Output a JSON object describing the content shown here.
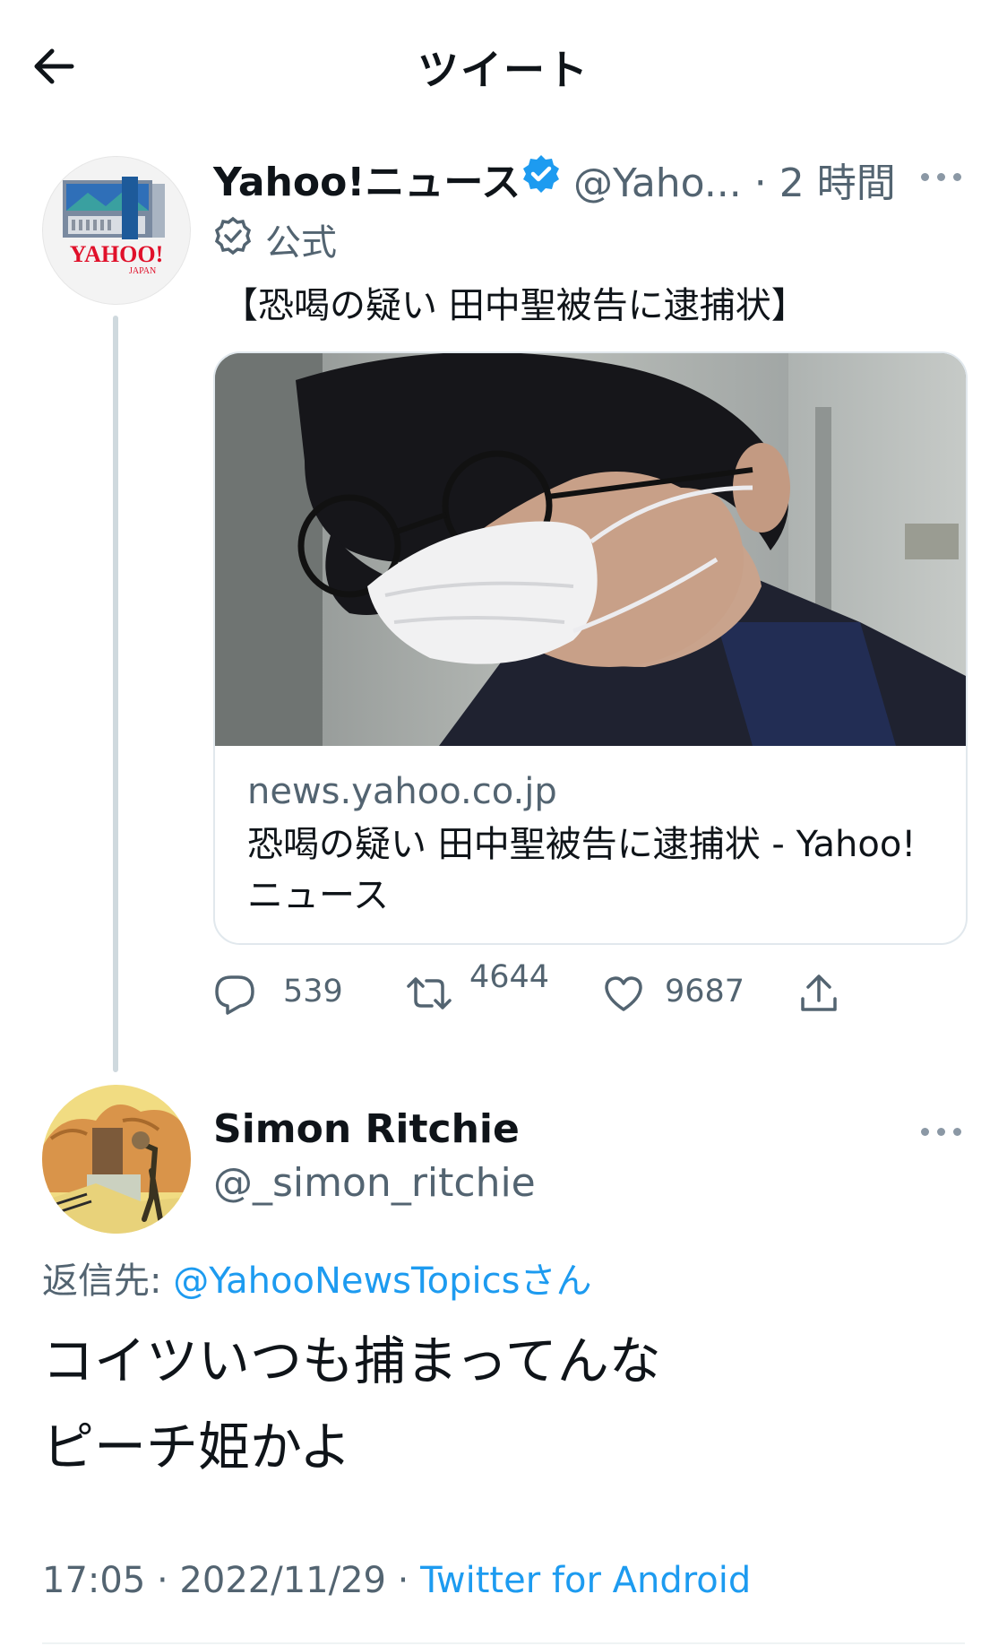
{
  "header": {
    "title": "ツイート"
  },
  "tweet1": {
    "author_name": "Yahoo!ニュース",
    "handle": "@Yaho...",
    "time": "· 2 時間",
    "official_label": "公式",
    "text": "【恐喝の疑い 田中聖被告に逮捕状】",
    "avatar_logo_text": "YAHOO!",
    "avatar_logo_sub": "JAPAN",
    "card": {
      "domain": "news.yahoo.co.jp",
      "title": "恐喝の疑い 田中聖被告に逮捕状 - Yahoo!ニュース"
    },
    "actions": {
      "replies": "539",
      "retweets": "4644",
      "likes": "9687"
    }
  },
  "tweet2": {
    "author_name": "Simon Ritchie",
    "handle": "@_simon_ritchie",
    "reply_to_label": "返信先: ",
    "reply_to_user": "@YahooNewsTopicsさん",
    "body_line1": "コイツいつも捕まってんな",
    "body_line2": "ピーチ姫かよ",
    "timestamp": "17:05 · 2022/11/29 · ",
    "source": "Twitter for Android"
  },
  "colors": {
    "accent": "#1d9bf0",
    "muted": "#536471",
    "verified": "#1d9bf0"
  },
  "icons": [
    "back-arrow-icon",
    "verified-badge-icon",
    "official-badge-icon",
    "more-icon",
    "reply-icon",
    "retweet-icon",
    "like-icon",
    "share-icon"
  ]
}
